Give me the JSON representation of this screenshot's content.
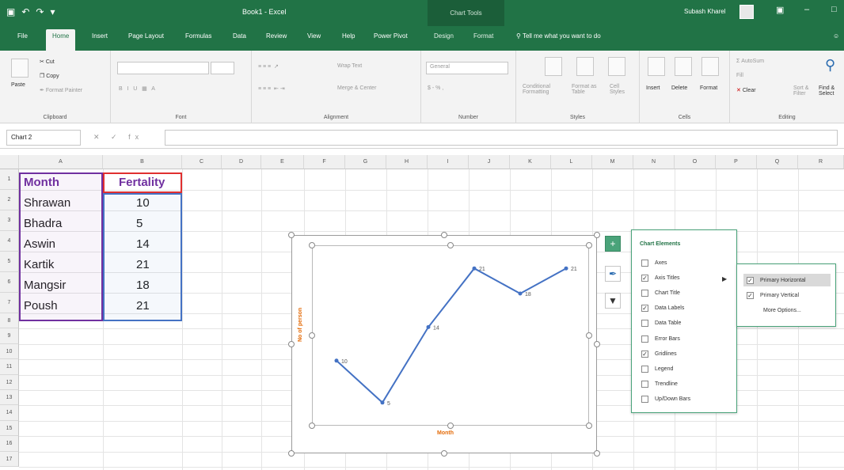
{
  "title_bar": {
    "document_title": "Book1  -  Excel",
    "context_title": "Chart Tools",
    "user_name": "Subash Kharel"
  },
  "tabs": [
    "File",
    "Home",
    "Insert",
    "Page Layout",
    "Formulas",
    "Data",
    "Review",
    "View",
    "Help",
    "Power Pivot",
    "Design",
    "Format"
  ],
  "tell_me": "Tell me what you want to do",
  "ribbon": {
    "clipboard": {
      "paste": "Paste",
      "cut": "Cut",
      "copy": "Copy",
      "format_painter": "Format Painter",
      "label": "Clipboard"
    },
    "font": {
      "label": "Font"
    },
    "alignment": {
      "wrap": "Wrap Text",
      "merge": "Merge & Center",
      "label": "Alignment"
    },
    "number": {
      "format": "General",
      "currency": "$ - % ,",
      "label": "Number"
    },
    "styles": {
      "conditional": "Conditional Formatting",
      "format_table": "Format as Table",
      "cell_styles": "Cell Styles",
      "label": "Styles"
    },
    "cells": {
      "insert": "Insert",
      "delete": "Delete",
      "format": "Format",
      "label": "Cells"
    },
    "editing": {
      "autosum": "AutoSum",
      "fill": "Fill",
      "clear": "Clear",
      "sort": "Sort & Filter",
      "find": "Find & Select",
      "label": "Editing"
    }
  },
  "formula_bar": {
    "name_box": "Chart 2",
    "fx": "fx",
    "content": ""
  },
  "columns": [
    "A",
    "B",
    "C",
    "D",
    "E",
    "F",
    "G",
    "H",
    "I",
    "J",
    "K",
    "L",
    "M",
    "N",
    "O",
    "P",
    "Q",
    "R"
  ],
  "rows": [
    "1",
    "2",
    "3",
    "4",
    "5",
    "6",
    "7",
    "8",
    "9",
    "10",
    "11",
    "12",
    "13",
    "14",
    "15",
    "16",
    "17"
  ],
  "table": {
    "header": [
      "Month",
      "Fertality"
    ],
    "rows": [
      [
        "Shrawan",
        "10"
      ],
      [
        "Bhadra",
        "5"
      ],
      [
        "Aswin",
        "14"
      ],
      [
        "Kartik",
        "21"
      ],
      [
        "Mangsir",
        "18"
      ],
      [
        "Poush",
        "21"
      ]
    ]
  },
  "chart_data": {
    "type": "line",
    "categories": [
      "Shrawan",
      "Bhadra",
      "Aswin",
      "Kartik",
      "Mangsir",
      "Poush"
    ],
    "series": [
      {
        "values": [
          10,
          5,
          14,
          21,
          18,
          21
        ]
      }
    ],
    "data_labels": [
      "10",
      "5",
      "14",
      "21",
      "18",
      "21"
    ],
    "xlabel": "Month",
    "ylabel": "No of person",
    "ylim": [
      3,
      23
    ],
    "line_color": "#4472c4",
    "axis_title_color": "#e46c0a"
  },
  "chart_elements": {
    "title": "Chart Elements",
    "items": [
      {
        "label": "Axes",
        "checked": false
      },
      {
        "label": "Axis Titles",
        "checked": true
      },
      {
        "label": "Chart Title",
        "checked": false
      },
      {
        "label": "Data Labels",
        "checked": true
      },
      {
        "label": "Data Table",
        "checked": false
      },
      {
        "label": "Error Bars",
        "checked": false
      },
      {
        "label": "Gridlines",
        "checked": true
      },
      {
        "label": "Legend",
        "checked": false
      },
      {
        "label": "Trendline",
        "checked": false
      },
      {
        "label": "Up/Down Bars",
        "checked": false
      }
    ],
    "submenu": [
      {
        "label": "Primary Horizontal",
        "checked": true
      },
      {
        "label": "Primary Vertical",
        "checked": true
      },
      {
        "label": "More Options..."
      }
    ]
  },
  "icons": {
    "chart_elements_button": "plus-icon",
    "chart_styles_button": "brush-icon",
    "chart_filters_button": "filter-icon"
  },
  "colors": {
    "excel_green": "#217346",
    "header_purple": "#7030a0",
    "range_blue": "#4472c4"
  }
}
